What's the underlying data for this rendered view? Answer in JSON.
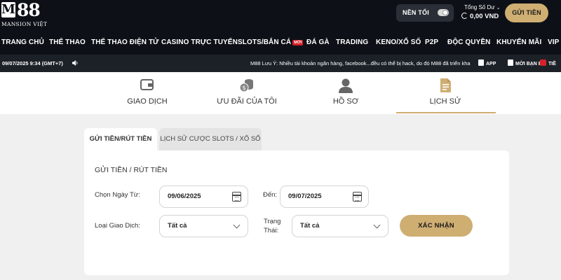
{
  "brand": {
    "logo_mark": "M",
    "logo_num": "88",
    "logo_sub": "MANSION  VIỆT"
  },
  "header": {
    "dark_mode_label": "NỀN TỐI",
    "balance_title": "Tổng Số Dư",
    "balance_value": "0,00 VND",
    "deposit_label": "GỬI TIỀN"
  },
  "nav": {
    "items": [
      {
        "label": "TRANG CHỦ"
      },
      {
        "label": "THỂ THAO"
      },
      {
        "label": "THỂ THAO ĐIỆN TỬ"
      },
      {
        "label": "CASINO TRỰC TUYẾN"
      },
      {
        "label": "SLOTS/BẮN CÁ",
        "badge": "MỚI"
      },
      {
        "label": "ĐÁ GÀ"
      },
      {
        "label": "TRADING"
      },
      {
        "label": "KENO/XỔ SỐ"
      },
      {
        "label": "P2P"
      },
      {
        "label": "ĐỘC QUYỀN"
      },
      {
        "label": "KHUYẾN MÃI"
      },
      {
        "label": "VIP"
      }
    ]
  },
  "ticker": {
    "datetime": "09/07/2025 9:34 (GMT+7)",
    "message": "M88 Lưu Ý: Nhiều tài khoản ngân hàng, facebook...đều có thể bị hack, do đó M88 đã triển khai",
    "app_label": "APP",
    "invite_label": "MỜI BẠN BÈ",
    "more_label": "TIỀ"
  },
  "tabs": [
    {
      "label": "GIAO DỊCH",
      "icon": "wallet-icon"
    },
    {
      "label": "ƯU ĐÃI CỦA TÔI",
      "icon": "coins-icon"
    },
    {
      "label": "HỒ SƠ",
      "icon": "user-icon"
    },
    {
      "label": "LỊCH SỬ",
      "icon": "document-icon",
      "active": true
    }
  ],
  "subtabs": {
    "active": "GỬI TIỀN/RÚT TIỀN",
    "inactive": "LỊCH SỬ CƯỢC SLOTS / XỔ SỐ"
  },
  "form": {
    "title": "GỬI TIỀN / RÚT TIỀN",
    "from_label": "Chọn Ngày Từ:",
    "from_value": "09/06/2025",
    "to_label": "Đến:",
    "to_value": "09/07/2025",
    "type_label": "Loại Giao Dịch:",
    "type_value": "Tất cả",
    "status_label_1": "Trạng",
    "status_label_2": "Thái:",
    "status_value": "Tất cả",
    "confirm_label": "XÁC NHẬN"
  },
  "colors": {
    "header_bg": "#0d1117",
    "ticker_bg": "#1c2128",
    "accent_gold": "#cfae72",
    "badge_red": "#d8202a"
  }
}
